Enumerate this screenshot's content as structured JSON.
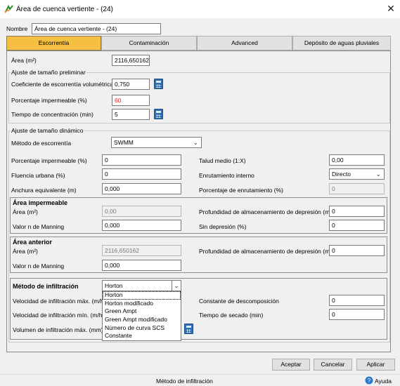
{
  "window": {
    "title": "Área de cuenca vertiente - (24)",
    "close_glyph": "✕"
  },
  "name_field": {
    "label": "Nombre",
    "value": "Área de cuenca vertiente - (24)"
  },
  "tabs": [
    {
      "label": "Escorrentía",
      "active": true
    },
    {
      "label": "Contaminación",
      "active": false
    },
    {
      "label": "Advanced",
      "active": false
    },
    {
      "label": "Depósito de aguas pluviales",
      "active": false
    }
  ],
  "area": {
    "label": "Área (m²)",
    "value": "2116,650162"
  },
  "preliminary": {
    "title": "Ajuste de tamaño preliminar",
    "runoff_coef": {
      "label": "Coeficiente de escorrentía volumétrica",
      "value": "0,750"
    },
    "impervious_pct": {
      "label": "Porcentaje impermeable (%)",
      "value": "60"
    },
    "concentration_time": {
      "label": "Tiempo de concentración (min)",
      "value": "5"
    }
  },
  "dynamic": {
    "title": "Ajuste de tamaño dinámico",
    "runoff_method": {
      "label": "Método de escorrentía",
      "value": "SWMM"
    },
    "impervious_pct": {
      "label": "Porcentaje impermeable (%)",
      "value": "0"
    },
    "urban_flow": {
      "label": "Fluencia urbana (%)",
      "value": "0"
    },
    "equivalent_width": {
      "label": "Anchura equivalente (m)",
      "value": "0,000"
    },
    "mean_slope": {
      "label": "Talud medio (1:X)",
      "value": "0,00"
    },
    "internal_routing": {
      "label": "Enrutamiento interno",
      "value": "Directo"
    },
    "routing_pct": {
      "label": "Porcentaje de enrutamiento (%)",
      "value": "0"
    }
  },
  "impervious_area": {
    "title": "Área impermeable",
    "area": {
      "label": "Área (m²)",
      "value": "0,00"
    },
    "manning": {
      "label": "Valor n de Manning",
      "value": "0,000"
    },
    "depression_depth": {
      "label": "Profundidad de almacenamiento de depresión (mm)",
      "value": "0"
    },
    "no_depression": {
      "label": "Sin depresión (%)",
      "value": "0"
    }
  },
  "pervious_area": {
    "title": "Área anterior",
    "area": {
      "label": "Área (m²)",
      "value": "2116,650162"
    },
    "manning": {
      "label": "Valor n de Manning",
      "value": "0,000"
    },
    "depression_depth": {
      "label": "Profundidad de almacenamiento de depresión (mm)",
      "value": "0"
    }
  },
  "infiltration": {
    "title": "Método de infiltración",
    "method_value": "Horton",
    "options": [
      "Horton",
      "Horton modificado",
      "Green Ampt",
      "Green Ampt modificado",
      "Número de curva SCS",
      "Constante"
    ],
    "max_rate": {
      "label": "Velocidad de infiltración máx. (m/h)"
    },
    "min_rate": {
      "label": "Velocidad de infiltración mín. (m/h)"
    },
    "max_volume": {
      "label": "Volumen de infiltración máx. (mm)"
    },
    "decay_constant": {
      "label": "Constante de descomposición",
      "value": "0"
    },
    "drying_time": {
      "label": "Tiempo de secado (min)",
      "value": "0"
    }
  },
  "buttons": {
    "accept": "Aceptar",
    "cancel": "Cancelar",
    "apply": "Aplicar"
  },
  "status": {
    "text": "Método de infiltración",
    "help": "Ayuda"
  }
}
